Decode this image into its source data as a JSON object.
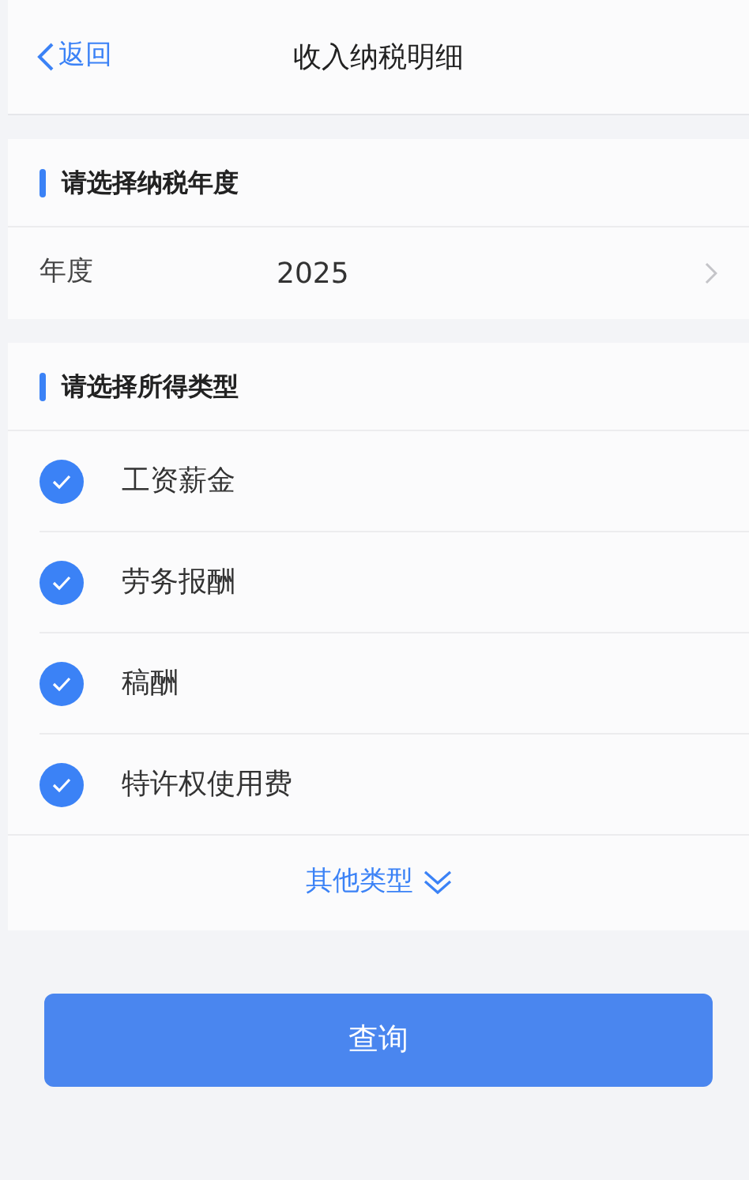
{
  "nav": {
    "back": "返回",
    "title": "收入纳税明细"
  },
  "year_section": {
    "title": "请选择纳税年度",
    "label": "年度",
    "value": "2025"
  },
  "type_section": {
    "title": "请选择所得类型",
    "items": [
      {
        "label": "工资薪金",
        "checked": true
      },
      {
        "label": "劳务报酬",
        "checked": true
      },
      {
        "label": "稿酬",
        "checked": true
      },
      {
        "label": "特许权使用费",
        "checked": true
      }
    ],
    "more": "其他类型"
  },
  "query_button": "查询"
}
